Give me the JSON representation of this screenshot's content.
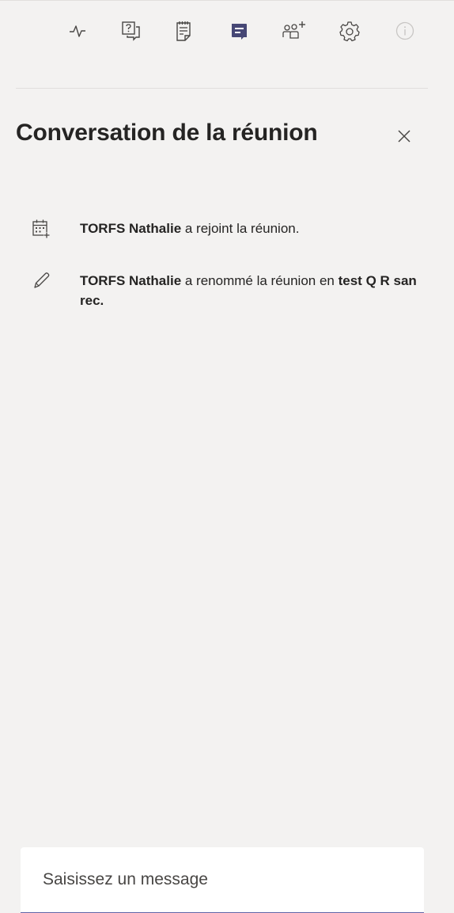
{
  "toolbar": {
    "items": [
      {
        "icon": "activity-icon",
        "name": "activity-button"
      },
      {
        "icon": "qna-icon",
        "name": "qna-button"
      },
      {
        "icon": "notes-icon",
        "name": "meeting-notes-button"
      },
      {
        "icon": "chat-icon",
        "name": "chat-button",
        "active": true
      },
      {
        "icon": "add-participants-icon",
        "name": "participants-button"
      },
      {
        "icon": "gear-icon",
        "name": "settings-button"
      },
      {
        "icon": "info-icon",
        "name": "info-button",
        "disabled": true
      }
    ],
    "active_color": "#464775",
    "icon_color": "#484644",
    "disabled_color": "#c8c6c4"
  },
  "chat": {
    "title": "Conversation de la réunion",
    "close_icon": "close-icon",
    "events": [
      {
        "icon": "calendar-join-icon",
        "actor": "TORFS Nathalie",
        "action": " a rejoint la réunion.",
        "target": ""
      },
      {
        "icon": "pencil-icon",
        "actor": "TORFS Nathalie",
        "action": " a renommé la réunion en ",
        "target": "test Q R san rec."
      }
    ]
  },
  "compose": {
    "placeholder": "Saisissez un message",
    "value": "",
    "accent": "#6264a7"
  }
}
